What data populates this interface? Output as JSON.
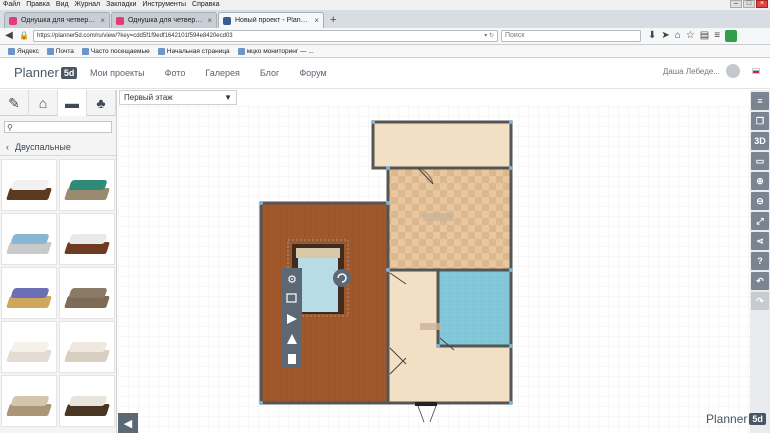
{
  "browser": {
    "menu": [
      "Файл",
      "Правка",
      "Вид",
      "Журнал",
      "Закладки",
      "Инструменты",
      "Справка"
    ],
    "tabs": [
      {
        "title": "Однушка для четверых...Где д...",
        "active": false
      },
      {
        "title": "Однушка для четверых...Где д...",
        "active": false
      },
      {
        "title": "Новый проект - Planner 5D",
        "active": true
      }
    ],
    "new_tab": "+",
    "url": "https://planner5d.com/ru/view/?key=cdd5f1f9edf1642101f594e8420ecd03",
    "search_placeholder": "Поиск",
    "bookmarks": [
      "Яндекс",
      "Почта",
      "Часто посещаемые",
      "Начальная страница",
      "мцко мониторинг — ..."
    ]
  },
  "app": {
    "logo_text": "Planner",
    "logo_badge": "5d",
    "nav": [
      "Мои проекты",
      "Фото",
      "Галерея",
      "Блог",
      "Форум"
    ],
    "user_name": "Даша Лебеде...",
    "floor": "Первый этаж",
    "category": "Двуспальные",
    "watermark_text": "Planner",
    "watermark_badge": "5d",
    "toolbar_3d": "3D",
    "colors": {
      "accent": "#4a5664",
      "wood_floor": "#a0582a",
      "tile": "#e6c9a4",
      "bath_tile": "#7fc6d8"
    }
  },
  "beds": [
    {
      "frame": "#5b3a22",
      "mattress": "#f1f1f1"
    },
    {
      "frame": "#9a8a70",
      "mattress": "#2f8a7a"
    },
    {
      "frame": "#c9c9c9",
      "mattress": "#89b6d4"
    },
    {
      "frame": "#6e3b22",
      "mattress": "#e9e9e9"
    },
    {
      "frame": "#cfa75c",
      "mattress": "#6a6fb6"
    },
    {
      "frame": "#7d6b55",
      "mattress": "#8a7a66"
    },
    {
      "frame": "#e3dcd2",
      "mattress": "#f4f0ea"
    },
    {
      "frame": "#d8cfc2",
      "mattress": "#efe8df"
    },
    {
      "frame": "#a89677",
      "mattress": "#d4c6ae"
    },
    {
      "frame": "#4a3424",
      "mattress": "#e8e4dc"
    }
  ]
}
